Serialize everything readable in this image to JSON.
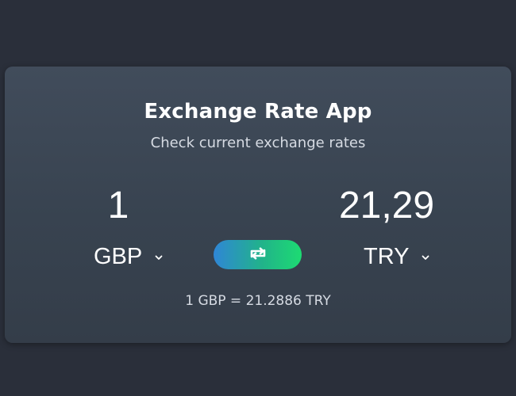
{
  "app": {
    "title": "Exchange Rate App",
    "subtitle": "Check current exchange rates"
  },
  "from": {
    "amount": "1",
    "currency": "GBP"
  },
  "to": {
    "amount": "21,29",
    "currency": "TRY"
  },
  "rate_text": "1 GBP = 21.2886 TRY",
  "colors": {
    "background": "#2a2f3a",
    "card_top": "#414c5b",
    "card_bottom": "#343d49",
    "swap_gradient_start": "#2f86d6",
    "swap_gradient_end": "#1ddb72",
    "text_primary": "#ffffff",
    "text_secondary": "#d6dbe3"
  },
  "icons": {
    "swap": "swap-arrows-icon",
    "dropdown": "chevron-down-icon"
  }
}
